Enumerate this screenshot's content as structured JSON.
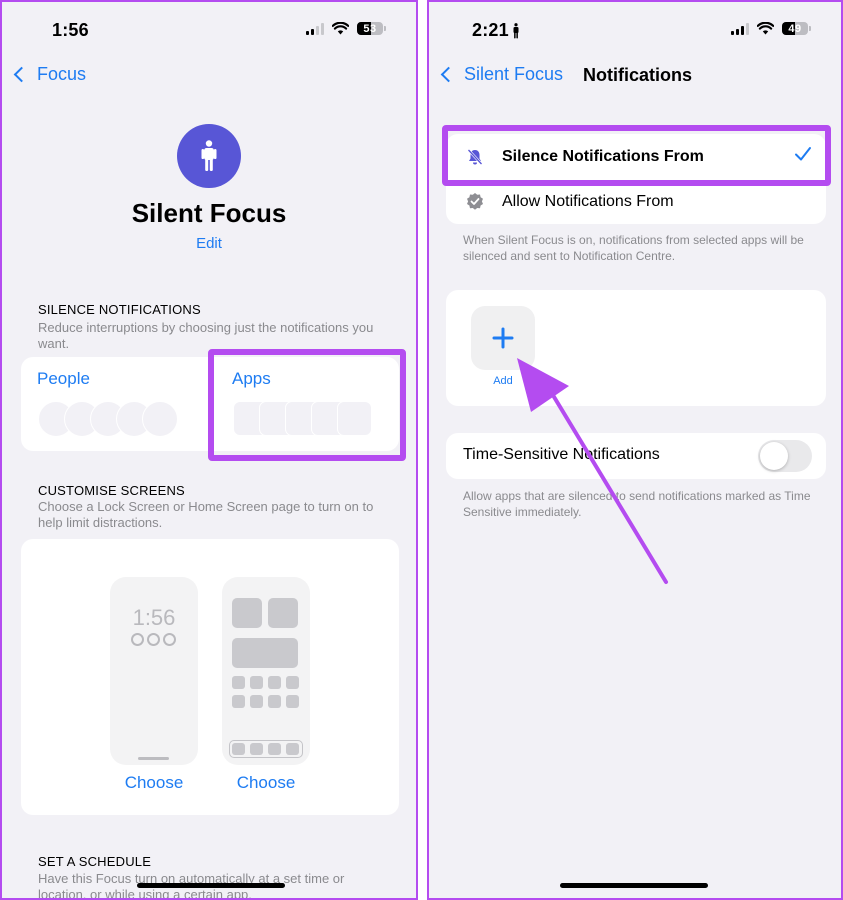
{
  "accent_color": "#1e7cf2",
  "highlight_color": "#b44cf0",
  "focus_color": "#5856d6",
  "left_screen": {
    "status_bar": {
      "time": "1:56",
      "signal_bars_active": 2,
      "signal_bars_total": 4,
      "wifi_icon": "wifi-icon",
      "battery_percent": "53"
    },
    "nav": {
      "back_label": "Focus"
    },
    "focus": {
      "icon": "person-standing-icon",
      "name": "Silent Focus",
      "edit_label": "Edit"
    },
    "silence_section": {
      "title": "SILENCE NOTIFICATIONS",
      "subtitle": "Reduce interruptions by choosing just the notifications you want.",
      "people_label": "People",
      "apps_label": "Apps"
    },
    "customise_section": {
      "title": "CUSTOMISE SCREENS",
      "subtitle": "Choose a Lock Screen or Home Screen page to turn on to help limit distractions.",
      "lock_preview_time": "1:56",
      "choose_lock_label": "Choose",
      "choose_home_label": "Choose"
    },
    "schedule_section": {
      "title": "SET A SCHEDULE",
      "subtitle": "Have this Focus turn on automatically at a set time or location, or while using a certain app."
    }
  },
  "right_screen": {
    "status_bar": {
      "time": "2:21",
      "focus_indicator_icon": "person-standing-icon",
      "signal_bars_active": 3,
      "signal_bars_total": 4,
      "wifi_icon": "wifi-icon",
      "battery_percent": "49"
    },
    "nav": {
      "back_label": "Silent Focus",
      "title": "Notifications"
    },
    "mode_options": [
      {
        "label": "Silence Notifications From",
        "icon": "bell-slash-icon",
        "selected": true
      },
      {
        "label": "Allow Notifications From",
        "icon": "checkmark-seal-icon",
        "selected": false
      }
    ],
    "mode_footnote": "When Silent Focus is on, notifications from selected apps will be silenced and sent to Notification Centre.",
    "add_label": "Add",
    "time_sensitive": {
      "label": "Time-Sensitive Notifications",
      "enabled": false,
      "footnote": "Allow apps that are silenced to send notifications marked as Time Sensitive immediately."
    }
  }
}
